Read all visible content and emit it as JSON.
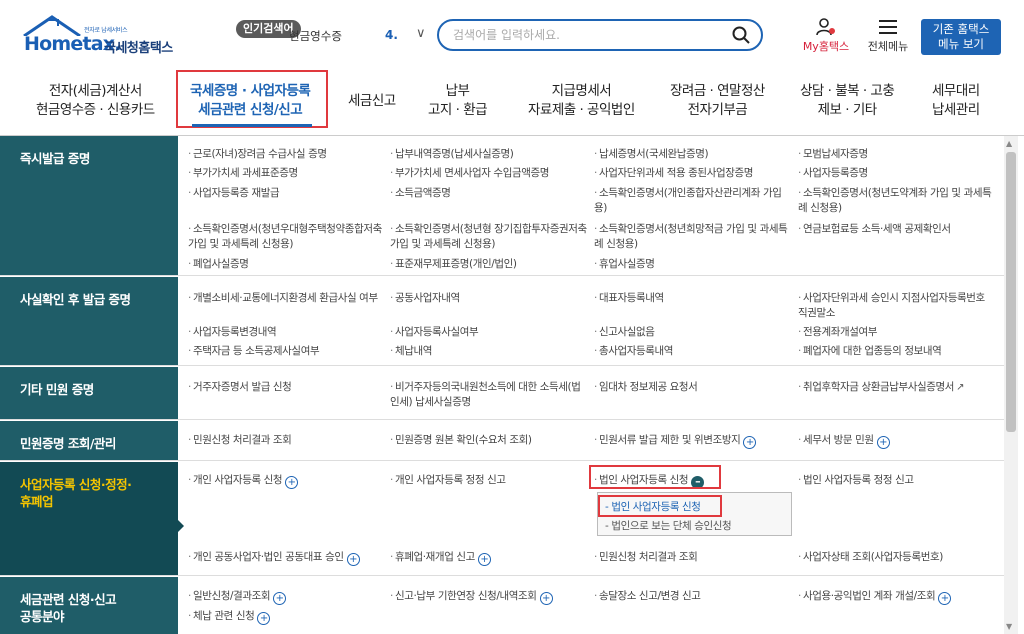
{
  "header": {
    "logo_tagline": "전자로 납세서비스",
    "logo_brand": "Hometax.",
    "logo_agency": "국세청홈택스",
    "popular_badge": "인기검색어",
    "popular_term": "현금영수증",
    "popular_rank": "4. ",
    "search_placeholder": "검색어를 입력하세요.",
    "my_home": "My홈택스",
    "all_menu": "전체메뉴",
    "classic_btn_line1": "기존 홈택스",
    "classic_btn_line2": "메뉴 보기"
  },
  "gnb": [
    {
      "line1": "전자(세금)계산서",
      "line2": "현금영수증 · 신용카드"
    },
    {
      "line1": "국세증명 · 사업자등록",
      "line2": "세금관련 신청/신고"
    },
    {
      "line1": "세금신고",
      "line2": ""
    },
    {
      "line1": "납부",
      "line2": "고지 · 환급"
    },
    {
      "line1": "지급명세서",
      "line2": "자료제출 · 공익법인"
    },
    {
      "line1": "장려금 · 연말정산",
      "line2": "전자기부금"
    },
    {
      "line1": "상담 · 불복 · 고충",
      "line2": "제보 · 기타"
    },
    {
      "line1": "세무대리",
      "line2": "납세관리"
    }
  ],
  "sections": [
    {
      "title": "즉시발급 증명",
      "items": [
        "근로(자녀)장려금 수급사실 증명",
        "납부내역증명(납세사실증명)",
        "납세증명서(국세완납증명)",
        "모범납세자증명",
        "부가가치세 과세표준증명",
        "부가가치세 면세사업자 수입금액증명",
        "사업자단위과세 적용 종된사업장증명",
        "사업자등록증명",
        "사업자등록증 재발급",
        "소득금액증명",
        "소득확인증명서(개인종합자산관리계좌 가입용)",
        "소득확인증명서(청년도약계좌 가입 및 과세특례 신청용)",
        "소득확인증명서(청년우대형주택청약종합저축 가입 및 과세특례 신청용)",
        "소득확인증명서(청년형 장기집합투자증권저축 가입 및 과세특례 신청용)",
        "소득확인증명서(청년희망적금 가입 및 과세특례 신청용)",
        "연금보험료등 소득·세액 공제확인서",
        "폐업사실증명",
        "표준재무제표증명(개인/법인)",
        "휴업사실증명"
      ]
    },
    {
      "title": "사실확인 후 발급 증명",
      "items": [
        "개별소비세·교통에너지환경세 환급사실 여부",
        "공동사업자내역",
        "대표자등록내역",
        "사업자단위과세 승인시 지점사업자등록번호 직권말소",
        "사업자등록변경내역",
        "사업자등록사실여부",
        "신고사실없음",
        "전용계좌개설여부",
        "주택자금 등 소득공제사실여부",
        "체납내역",
        "총사업자등록내역",
        "폐업자에 대한 업종등의 정보내역"
      ]
    },
    {
      "title": "기타 민원 증명",
      "items": [
        "거주자증명서 발급 신청",
        "비거주자등의국내원천소득에 대한 소득세(법인세) 납세사실증명",
        "임대차 정보제공 요청서",
        "취업후학자금 상환금납부사실증명서"
      ]
    },
    {
      "title": "민원증명 조회/관리",
      "items": [
        "민원신청 처리결과 조회",
        "민원증명 원본 확인(수요처 조회)",
        "민원서류 발급 제한 및 위변조방지",
        "세무서 방문 민원"
      ]
    },
    {
      "title_line1": "사업자등록 신청·정정·",
      "title_line2": "휴폐업",
      "items": [
        "개인 사업자등록 신청",
        "개인 사업자등록 정정 신고",
        "법인 사업자등록 신청",
        "법인 사업자등록 정정 신고",
        "개인 공동사업자·법인 공동대표 승인",
        "휴폐업·재개업 신고",
        "민원신청 처리결과 조회",
        "사업자상태 조회(사업자등록번호)"
      ],
      "submenu": [
        "- 법인 사업자등록 신청",
        "- 법인으로 보는 단체 승인신청"
      ]
    },
    {
      "title_line1": "세금관련 신청·신고",
      "title_line2": "공통분야",
      "items": [
        "일반신청/결과조회",
        "신고·납부 기한연장 신청/내역조회",
        "송달장소 신고/변경 신고",
        "사업용·공익법인 계좌 개설/조회",
        "체납 관련 신청"
      ]
    }
  ]
}
